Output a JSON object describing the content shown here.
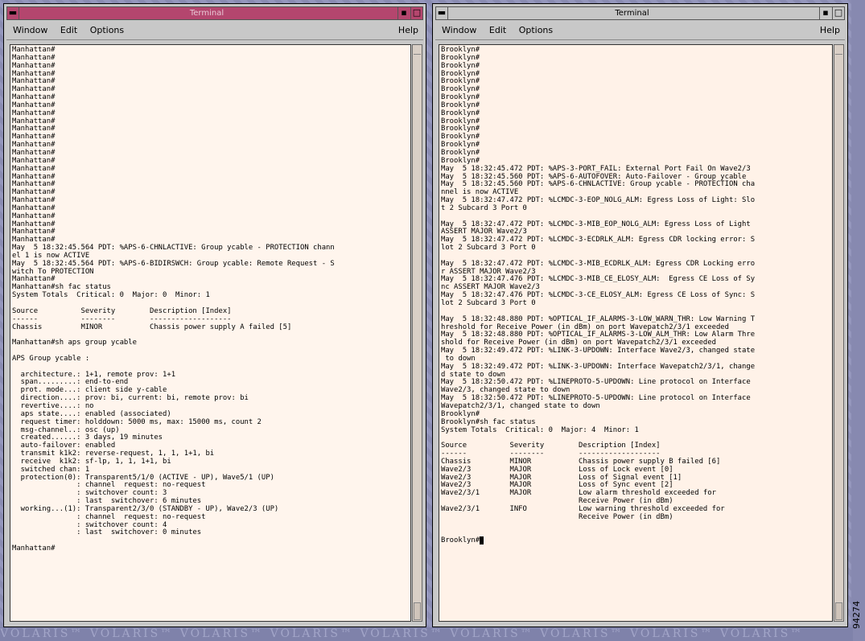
{
  "wallpaper": {
    "strip_text": "VOLARIS™  VOLARIS™  VOLARIS™  VOLARIS™  VOLARIS™  VOLARIS™  VOLARIS™  VOLARIS™  VOLARIS™"
  },
  "figure_number": "94274",
  "colors": {
    "active_titlebar": "#b4466e",
    "inactive_titlebar": "#c6c6c6",
    "terminal_bg": "#fff5ed"
  },
  "left": {
    "title": "Terminal",
    "menu": {
      "window": "Window",
      "edit": "Edit",
      "options": "Options",
      "help": "Help"
    },
    "lines": [
      "Manhattan#",
      "Manhattan#",
      "Manhattan#",
      "Manhattan#",
      "Manhattan#",
      "Manhattan#",
      "Manhattan#",
      "Manhattan#",
      "Manhattan#",
      "Manhattan#",
      "Manhattan#",
      "Manhattan#",
      "Manhattan#",
      "Manhattan#",
      "Manhattan#",
      "Manhattan#",
      "Manhattan#",
      "Manhattan#",
      "Manhattan#",
      "Manhattan#",
      "Manhattan#",
      "Manhattan#",
      "Manhattan#",
      "Manhattan#",
      "Manhattan#",
      "May  5 18:32:45.564 PDT: %APS-6-CHNLACTIVE: Group ycable - PROTECTION chann",
      "el 1 is now ACTIVE",
      "May  5 18:32:45.564 PDT: %APS-6-BIDIRSWCH: Group ycable: Remote Request - S",
      "witch To PROTECTION",
      "Manhattan#",
      "Manhattan#sh fac status",
      "System Totals  Critical: 0  Major: 0  Minor: 1",
      "",
      "Source          Severity        Description [Index]",
      "------          --------        -------------------",
      "Chassis         MINOR           Chassis power supply A failed [5]",
      "",
      "Manhattan#sh aps group ycable",
      "",
      "APS Group ycable :",
      "",
      "  architecture.: 1+1, remote prov: 1+1",
      "  span.........: end-to-end",
      "  prot. mode...: client side y-cable",
      "  direction....: prov: bi, current: bi, remote prov: bi",
      "  revertive....: no",
      "  aps state....: enabled (associated)",
      "  request timer: holddown: 5000 ms, max: 15000 ms, count 2",
      "  msg-channel..: osc (up)",
      "  created......: 3 days, 19 minutes",
      "  auto-failover: enabled",
      "  transmit k1k2: reverse-request, 1, 1, 1+1, bi",
      "  receive  k1k2: sf-lp, 1, 1, 1+1, bi",
      "  switched chan: 1",
      "  protection(0): Transparent5/1/0 (ACTIVE - UP), Wave5/1 (UP)",
      "               : channel  request: no-request",
      "               : switchover count: 3",
      "               : last  switchover: 6 minutes",
      "  working...(1): Transparent2/3/0 (STANDBY - UP), Wave2/3 (UP)",
      "               : channel  request: no-request",
      "               : switchover count: 4",
      "               : last  switchover: 0 minutes",
      "",
      "Manhattan#"
    ]
  },
  "right": {
    "title": "Terminal",
    "menu": {
      "window": "Window",
      "edit": "Edit",
      "options": "Options",
      "help": "Help"
    },
    "lines": [
      "Brooklyn#",
      "Brooklyn#",
      "Brooklyn#",
      "Brooklyn#",
      "Brooklyn#",
      "Brooklyn#",
      "Brooklyn#",
      "Brooklyn#",
      "Brooklyn#",
      "Brooklyn#",
      "Brooklyn#",
      "Brooklyn#",
      "Brooklyn#",
      "Brooklyn#",
      "Brooklyn#",
      "May  5 18:32:45.472 PDT: %APS-3-PORT_FAIL: External Port Fail On Wave2/3",
      "May  5 18:32:45.560 PDT: %APS-6-AUTOFOVER: Auto-Failover - Group ycable",
      "May  5 18:32:45.560 PDT: %APS-6-CHNLACTIVE: Group ycable - PROTECTION cha",
      "nnel is now ACTIVE",
      "May  5 18:32:47.472 PDT: %LCMDC-3-EOP_NOLG_ALM: Egress Loss of Light: Slo",
      "t 2 Subcard 3 Port 0",
      "",
      "May  5 18:32:47.472 PDT: %LCMDC-3-MIB_EOP_NOLG_ALM: Egress Loss of Light",
      "ASSERT MAJOR Wave2/3",
      "May  5 18:32:47.472 PDT: %LCMDC-3-ECDRLK_ALM: Egress CDR locking error: S",
      "lot 2 Subcard 3 Port 0",
      "",
      "May  5 18:32:47.472 PDT: %LCMDC-3-MIB_ECDRLK_ALM: Egress CDR Locking erro",
      "r ASSERT MAJOR Wave2/3",
      "May  5 18:32:47.476 PDT: %LCMDC-3-MIB_CE_ELOSY_ALM:  Egress CE Loss of Sy",
      "nc ASSERT MAJOR Wave2/3",
      "May  5 18:32:47.476 PDT: %LCMDC-3-CE_ELOSY_ALM: Egress CE Loss of Sync: S",
      "lot 2 Subcard 3 Port 0",
      "",
      "May  5 18:32:48.880 PDT: %OPTICAL_IF_ALARMS-3-LOW_WARN_THR: Low Warning T",
      "hreshold for Receive Power (in dBm) on port Wavepatch2/3/1 exceeded",
      "May  5 18:32:48.880 PDT: %OPTICAL_IF_ALARMS-3-LOW_ALM_THR: Low Alarm Thre",
      "shold for Receive Power (in dBm) on port Wavepatch2/3/1 exceeded",
      "May  5 18:32:49.472 PDT: %LINK-3-UPDOWN: Interface Wave2/3, changed state",
      " to down",
      "May  5 18:32:49.472 PDT: %LINK-3-UPDOWN: Interface Wavepatch2/3/1, change",
      "d state to down",
      "May  5 18:32:50.472 PDT: %LINEPROTO-5-UPDOWN: Line protocol on Interface",
      "Wave2/3, changed state to down",
      "May  5 18:32:50.472 PDT: %LINEPROTO-5-UPDOWN: Line protocol on Interface",
      "Wavepatch2/3/1, changed state to down",
      "Brooklyn#",
      "Brooklyn#sh fac status",
      "System Totals  Critical: 0  Major: 4  Minor: 1",
      "",
      "Source          Severity        Description [Index]",
      "------          --------        -------------------",
      "Chassis         MINOR           Chassis power supply B failed [6]",
      "Wave2/3         MAJOR           Loss of Lock event [0]",
      "Wave2/3         MAJOR           Loss of Signal event [1]",
      "Wave2/3         MAJOR           Loss of Sync event [2]",
      "Wave2/3/1       MAJOR           Low alarm threshold exceeded for",
      "                                Receive Power (in dBm)",
      "Wave2/3/1       INFO            Low warning threshold exceeded for",
      "                                Receive Power (in dBm)",
      "",
      "",
      "Brooklyn#"
    ]
  }
}
